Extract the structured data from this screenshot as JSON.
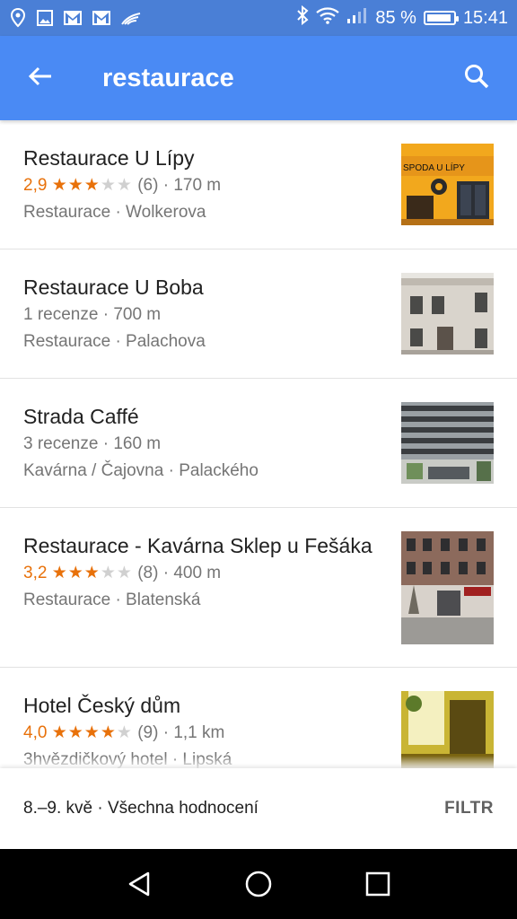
{
  "status_bar": {
    "battery_percent": "85 %",
    "time": "15:41",
    "icons": [
      "location-icon",
      "image-icon",
      "gmail-icon",
      "gmail-icon",
      "cast-icon",
      "bluetooth-icon",
      "wifi-icon",
      "signal-icon",
      "battery-icon"
    ]
  },
  "app_bar": {
    "back_icon": "arrow-left-icon",
    "title": "restaurace",
    "search_icon": "search-icon"
  },
  "colors": {
    "accent": "#4a8af4",
    "rating": "#e8710a",
    "secondary_text": "#757575"
  },
  "results": [
    {
      "name": "Restaurace U Lípy",
      "rating": "2,9",
      "stars": 3,
      "meta": "(6) · 170 m",
      "category": "Restaurace · Wolkerova"
    },
    {
      "name": "Restaurace U Boba",
      "meta": "1 recenze · 700 m",
      "category": "Restaurace · Palachova"
    },
    {
      "name": "Strada Caffé",
      "meta": "3 recenze · 160 m",
      "category": "Kavárna / Čajovna · Palackého"
    },
    {
      "name": "Restaurace - Kavárna Sklep u Fešáka",
      "rating": "3,2",
      "stars": 3,
      "meta": "(8) · 400 m",
      "category": "Restaurace · Blatenská"
    },
    {
      "name": "Hotel Český dům",
      "rating": "4,0",
      "stars": 4,
      "meta": "(9) · 1,1 km",
      "category": "3hvězdičkový hotel · Lipská"
    }
  ],
  "thumbnail_sign": "SPODA U LÍPY",
  "filter_bar": {
    "summary": "8.–9. kvě · Všechna hodnocení",
    "filter_label": "FILTR"
  },
  "nav_bar": {
    "icons": [
      "back-triangle-icon",
      "home-circle-icon",
      "recents-square-icon"
    ]
  }
}
